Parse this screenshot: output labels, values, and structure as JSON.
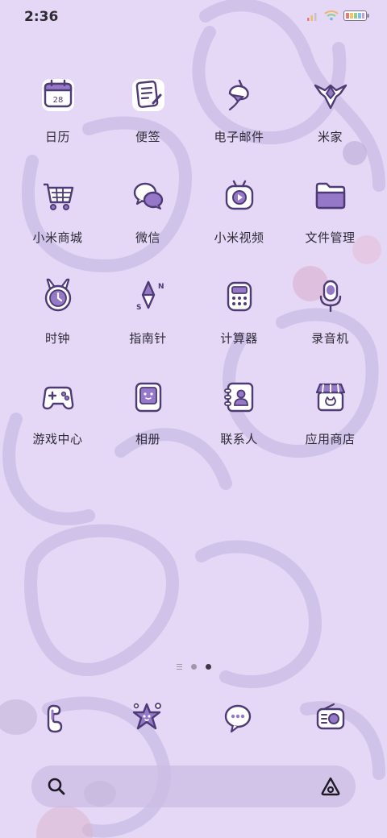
{
  "status_bar": {
    "time": "2:36",
    "icons": [
      "signal-bars-icon",
      "wifi-icon",
      "battery-icon"
    ]
  },
  "apps": [
    {
      "label": "日历",
      "icon": "calendar-icon",
      "date": "28"
    },
    {
      "label": "便签",
      "icon": "notes-icon"
    },
    {
      "label": "电子邮件",
      "icon": "email-icon"
    },
    {
      "label": "米家",
      "icon": "mijia-icon"
    },
    {
      "label": "小米商城",
      "icon": "shopping-cart-icon"
    },
    {
      "label": "微信",
      "icon": "wechat-icon"
    },
    {
      "label": "小米视频",
      "icon": "video-icon"
    },
    {
      "label": "文件管理",
      "icon": "folder-icon"
    },
    {
      "label": "时钟",
      "icon": "clock-icon"
    },
    {
      "label": "指南针",
      "icon": "compass-icon"
    },
    {
      "label": "计算器",
      "icon": "calculator-icon"
    },
    {
      "label": "录音机",
      "icon": "microphone-icon"
    },
    {
      "label": "游戏中心",
      "icon": "gamepad-icon"
    },
    {
      "label": "相册",
      "icon": "gallery-icon"
    },
    {
      "label": "联系人",
      "icon": "contacts-icon"
    },
    {
      "label": "应用商店",
      "icon": "app-store-icon"
    }
  ],
  "page_indicator": {
    "pages": 2,
    "current": 2,
    "has_feed_page": true
  },
  "dock": [
    "phone-icon",
    "camera-icon",
    "messages-icon",
    "music-radio-icon"
  ],
  "search_bar": {
    "left_icon": "search-icon",
    "right_icon": "assistant-icon"
  },
  "colors": {
    "background": "#e3d6f5",
    "icon_purple": "#7e5fb3",
    "icon_outline": "#4e3a74",
    "label_text": "#2f2a38"
  }
}
